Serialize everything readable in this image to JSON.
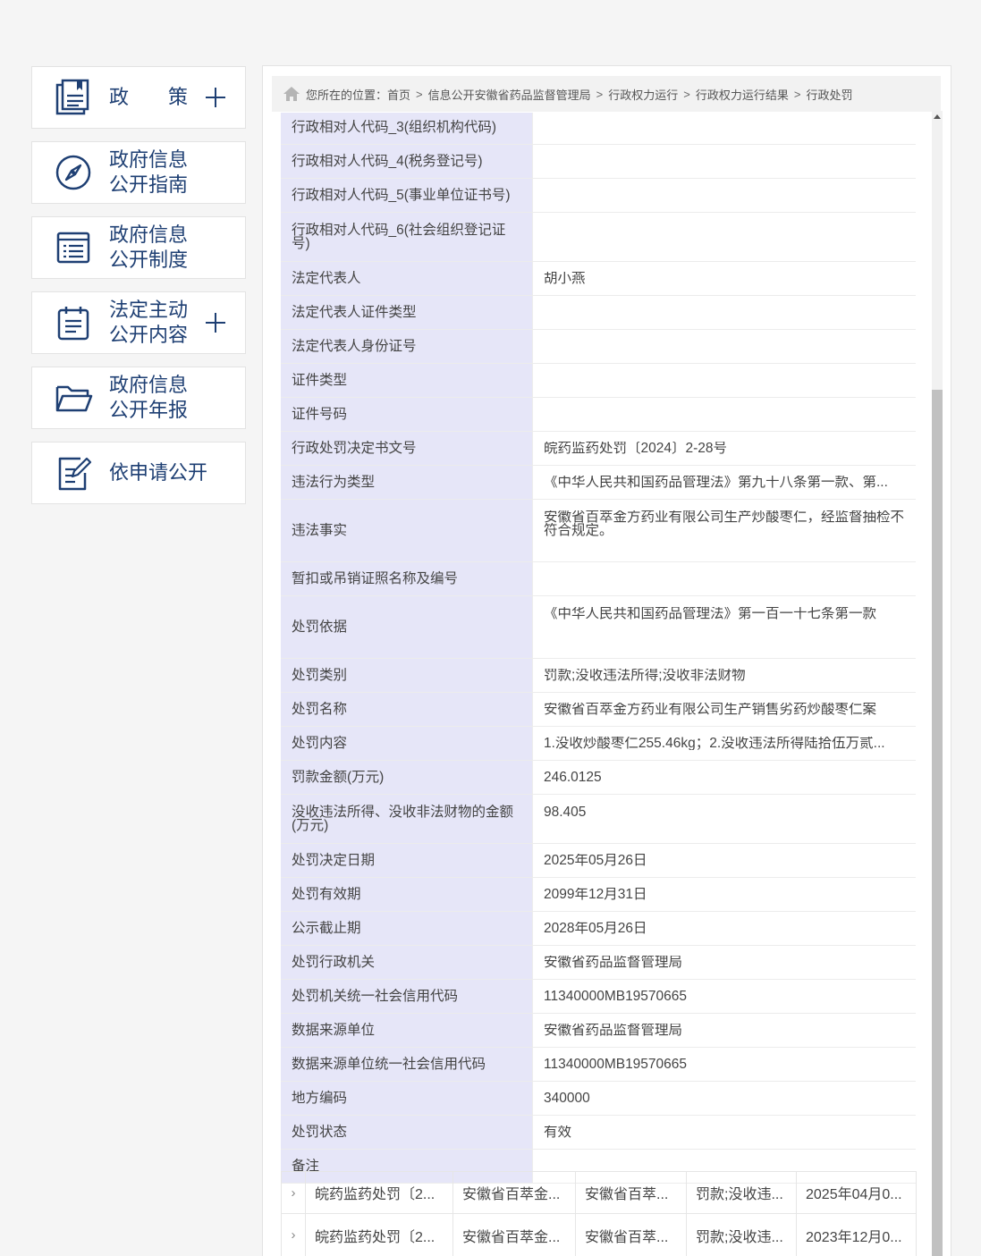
{
  "sidebar": {
    "items": [
      {
        "label": "政策",
        "icon": "book-icon",
        "expand": true
      },
      {
        "label": "政府信息\n公开指南",
        "icon": "compass-icon",
        "expand": false
      },
      {
        "label": "政府信息\n公开制度",
        "icon": "list-doc-icon",
        "expand": false
      },
      {
        "label": "法定主动\n公开内容",
        "icon": "clipboard-icon",
        "expand": true
      },
      {
        "label": "政府信息\n公开年报",
        "icon": "folder-icon",
        "expand": false
      },
      {
        "label": "依申请公开",
        "icon": "edit-icon",
        "expand": false
      }
    ]
  },
  "breadcrumb": {
    "prefix": "您所在的位置：",
    "items": [
      "首页",
      "信息公开安徽省药品监督管理局",
      "行政权力运行",
      "行政权力运行结果",
      "行政处罚"
    ],
    "separator": ">"
  },
  "detail": {
    "rows": [
      {
        "key": "行政相对人代码_3(组织机构代码)",
        "value": ""
      },
      {
        "key": "行政相对人代码_4(税务登记号)",
        "value": ""
      },
      {
        "key": "行政相对人代码_5(事业单位证书号)",
        "value": ""
      },
      {
        "key": "行政相对人代码_6(社会组织登记证号)",
        "value": ""
      },
      {
        "key": "法定代表人",
        "value": "胡小燕"
      },
      {
        "key": "法定代表人证件类型",
        "value": ""
      },
      {
        "key": "法定代表人身份证号",
        "value": ""
      },
      {
        "key": "证件类型",
        "value": ""
      },
      {
        "key": "证件号码",
        "value": ""
      },
      {
        "key": "行政处罚决定书文号",
        "value": "皖药监药处罚〔2024〕2-28号"
      },
      {
        "key": "违法行为类型",
        "value": "《中华人民共和国药品管理法》第九十八条第一款、第..."
      },
      {
        "key": "违法事实",
        "value": "安徽省百萃金方药业有限公司生产炒酸枣仁，经监督抽检不符合规定。"
      },
      {
        "key": "暂扣或吊销证照名称及编号",
        "value": ""
      },
      {
        "key": "处罚依据",
        "value": "《中华人民共和国药品管理法》第一百一十七条第一款"
      },
      {
        "key": "处罚类别",
        "value": "罚款;没收违法所得;没收非法财物"
      },
      {
        "key": "处罚名称",
        "value": "安徽省百萃金方药业有限公司生产销售劣药炒酸枣仁案"
      },
      {
        "key": "处罚内容",
        "value": "1.没收炒酸枣仁255.46kg；2.没收违法所得陆拾伍万贰..."
      },
      {
        "key": "罚款金额(万元)",
        "value": "246.0125"
      },
      {
        "key": "没收违法所得、没收非法财物的金额(万元)",
        "value": "98.405"
      },
      {
        "key": "处罚决定日期",
        "value": "2025年05月26日"
      },
      {
        "key": "处罚有效期",
        "value": "2099年12月31日"
      },
      {
        "key": "公示截止期",
        "value": "2028年05月26日"
      },
      {
        "key": "处罚行政机关",
        "value": "安徽省药品监督管理局"
      },
      {
        "key": "处罚机关统一社会信用代码",
        "value": "11340000MB19570665"
      },
      {
        "key": "数据来源单位",
        "value": "安徽省药品监督管理局"
      },
      {
        "key": "数据来源单位统一社会信用代码",
        "value": "11340000MB19570665"
      },
      {
        "key": "地方编码",
        "value": "340000"
      },
      {
        "key": "处罚状态",
        "value": "有效"
      },
      {
        "key": "备注",
        "value": ""
      }
    ]
  },
  "results": [
    {
      "doc": "皖药监药处罚〔2...",
      "party": "安徽省百萃金...",
      "name": "安徽省百萃...",
      "category": "罚款;没收违...",
      "date": "2025年04月0..."
    },
    {
      "doc": "皖药监药处罚〔2...",
      "party": "安徽省百萃金...",
      "name": "安徽省百萃...",
      "category": "罚款;没收违...",
      "date": "2023年12月0..."
    }
  ],
  "colors": {
    "accent": "#1e3f73",
    "keyBg": "#e6e6f8"
  }
}
